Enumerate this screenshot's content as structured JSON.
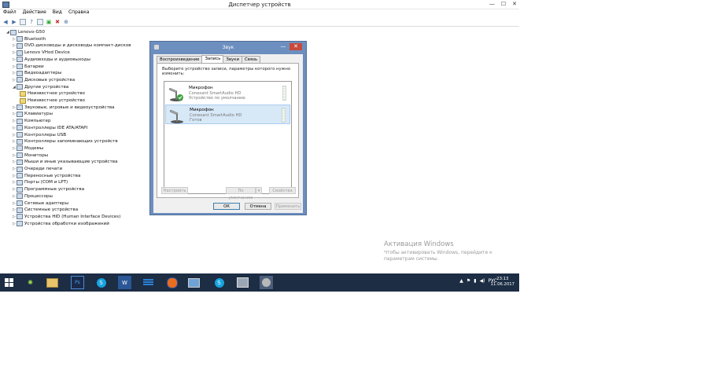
{
  "window": {
    "title": "Диспетчер устройств",
    "controls": [
      "—",
      "☐",
      "✕"
    ]
  },
  "menu": [
    "Файл",
    "Действие",
    "Вид",
    "Справка"
  ],
  "toolbar": {
    "icons": [
      "back-arrow-icon",
      "forward-arrow-icon",
      "properties-icon",
      "help-icon",
      "scan-icon",
      "disable-icon",
      "uninstall-icon",
      "update-driver-icon"
    ]
  },
  "tree": {
    "root": "Lenovo-G50",
    "items": [
      {
        "label": "Bluetooth",
        "level": 1,
        "expanded": false
      },
      {
        "label": "DVD-дисководы и дисководы компакт-дисков",
        "level": 1,
        "expanded": false
      },
      {
        "label": "Lenovo VHod Device",
        "level": 1,
        "expanded": false
      },
      {
        "label": "Аудиовходы и аудиовыходы",
        "level": 1,
        "expanded": false
      },
      {
        "label": "Батареи",
        "level": 1,
        "expanded": false
      },
      {
        "label": "Видеоадаптеры",
        "level": 1,
        "expanded": false
      },
      {
        "label": "Дисковые устройства",
        "level": 1,
        "expanded": false
      },
      {
        "label": "Другие устройства",
        "level": 1,
        "expanded": true
      },
      {
        "label": "Неизвестное устройство",
        "level": 2,
        "warning": true
      },
      {
        "label": "Неизвестное устройство",
        "level": 2,
        "warning": true
      },
      {
        "label": "Звуковые, игровые и видеоустройства",
        "level": 1,
        "expanded": false
      },
      {
        "label": "Клавиатуры",
        "level": 1,
        "expanded": false
      },
      {
        "label": "Компьютер",
        "level": 1,
        "expanded": false
      },
      {
        "label": "Контроллеры IDE ATA/ATAPI",
        "level": 1,
        "expanded": false
      },
      {
        "label": "Контроллеры USB",
        "level": 1,
        "expanded": false
      },
      {
        "label": "Контроллеры запоминающих устройств",
        "level": 1,
        "expanded": false
      },
      {
        "label": "Модемы",
        "level": 1,
        "expanded": false
      },
      {
        "label": "Мониторы",
        "level": 1,
        "expanded": false
      },
      {
        "label": "Мыши и иные указывающие устройства",
        "level": 1,
        "expanded": false
      },
      {
        "label": "Очереди печати",
        "level": 1,
        "expanded": false
      },
      {
        "label": "Переносные устройства",
        "level": 1,
        "expanded": false
      },
      {
        "label": "Порты (COM и LPT)",
        "level": 1,
        "expanded": false
      },
      {
        "label": "Программные устройства",
        "level": 1,
        "expanded": false
      },
      {
        "label": "Процессоры",
        "level": 1,
        "expanded": false
      },
      {
        "label": "Сетевые адаптеры",
        "level": 1,
        "expanded": false
      },
      {
        "label": "Системные устройства",
        "level": 1,
        "expanded": false
      },
      {
        "label": "Устройства HID (Human Interface Devices)",
        "level": 1,
        "expanded": false
      },
      {
        "label": "Устройства обработки изображений",
        "level": 1,
        "expanded": false
      }
    ]
  },
  "dialog": {
    "title": "Звук",
    "close": "✕",
    "minimize": "—",
    "tabs": [
      {
        "label": "Воспроизведение",
        "active": false
      },
      {
        "label": "Запись",
        "active": true
      },
      {
        "label": "Звуки",
        "active": false
      },
      {
        "label": "Связь",
        "active": false
      }
    ],
    "instruction": "Выберите устройство записи, параметры которого нужно изменить:",
    "devices": [
      {
        "name": "Микрофон",
        "driver": "Conexant SmartAudio HD",
        "status": "Устройство по умолчанию",
        "default": true,
        "selected": false
      },
      {
        "name": "Микрофон",
        "driver": "Conexant SmartAudio HD",
        "status": "Готов",
        "default": false,
        "selected": true
      }
    ],
    "buttons": {
      "configure": "Настроить",
      "set_default": "По умолчанию",
      "dropdown": "▾",
      "properties": "Свойства",
      "ok": "ОК",
      "cancel": "Отмена",
      "apply": "Применить"
    }
  },
  "watermark": {
    "title": "Активация Windows",
    "text": "Чтобы активировать Windows, перейдите к параметрам системы."
  },
  "taskbar": {
    "apps": [
      "start-icon",
      "tool-icon",
      "file-explorer-icon",
      "photoshop-icon",
      "skype-icon",
      "word-icon",
      "stack-icon",
      "firefox-icon",
      "remote-icon",
      "skype-icon-2",
      "device-manager-icon",
      "sound-icon"
    ],
    "tray": {
      "lang": "РУС",
      "icons": [
        "arrow-up-icon",
        "flag-icon",
        "network-icon",
        "speaker-icon"
      ]
    },
    "clock": {
      "time": "23:13",
      "date": "11.06.2017"
    }
  },
  "colors": {
    "taskbar": "#1c2d44",
    "dialog_frame": "#6d8fbf",
    "close": "#c74a3c",
    "selection": "#d7e8f7",
    "watermark": "#9a9a9a"
  }
}
